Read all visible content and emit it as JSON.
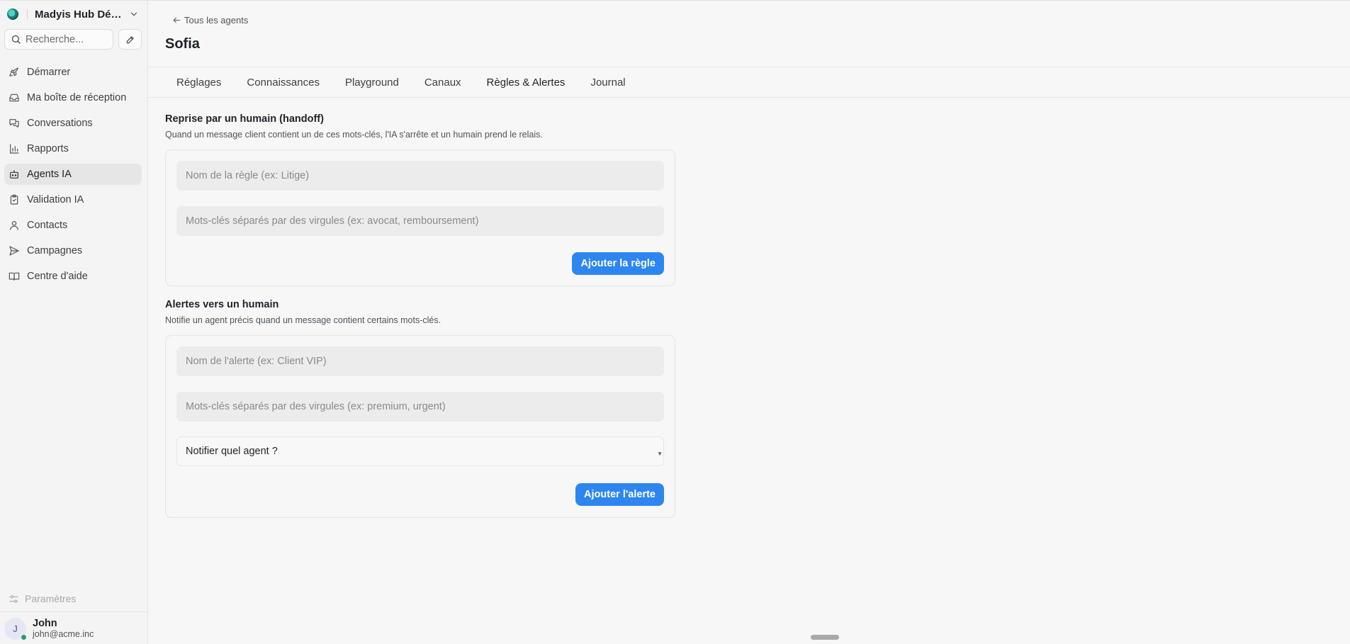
{
  "sidebar": {
    "workspace_name": "Madyis Hub Démo",
    "search_placeholder": "Recherche...",
    "items": [
      {
        "label": "Démarrer",
        "icon": "rocket-icon"
      },
      {
        "label": "Ma boîte de réception",
        "icon": "inbox-icon"
      },
      {
        "label": "Conversations",
        "icon": "chat-bubbles-icon"
      },
      {
        "label": "Rapports",
        "icon": "bar-chart-icon"
      },
      {
        "label": "Agents IA",
        "icon": "robot-icon",
        "active": true
      },
      {
        "label": "Validation IA",
        "icon": "clipboard-check-icon"
      },
      {
        "label": "Contacts",
        "icon": "user-icon"
      },
      {
        "label": "Campagnes",
        "icon": "send-icon"
      },
      {
        "label": "Centre d'aide",
        "icon": "book-icon"
      }
    ],
    "settings_label": "Paramètres",
    "user": {
      "initial": "J",
      "name": "John",
      "email": "john@acme.inc",
      "status_color": "#22a06b"
    }
  },
  "header": {
    "back_label": "Tous les agents",
    "title": "Sofia",
    "tabs": [
      {
        "label": "Réglages"
      },
      {
        "label": "Connaissances"
      },
      {
        "label": "Playground"
      },
      {
        "label": "Canaux"
      },
      {
        "label": "Règles & Alertes",
        "active": true
      },
      {
        "label": "Journal"
      }
    ]
  },
  "handoff": {
    "title": "Reprise par un humain (handoff)",
    "description": "Quand un message client contient un de ces mots-clés, l'IA s'arrête et un humain prend le relais.",
    "name_placeholder": "Nom de la règle (ex: Litige)",
    "keywords_placeholder": "Mots-clés séparés par des virgules (ex: avocat, remboursement)",
    "button_label": "Ajouter la règle"
  },
  "alerts": {
    "title": "Alertes vers un humain",
    "description": "Notifie un agent précis quand un message contient certains mots-clés.",
    "name_placeholder": "Nom de l'alerte (ex: Client VIP)",
    "keywords_placeholder": "Mots-clés séparés par des virgules (ex: premium, urgent)",
    "agent_select_label": "Notifier quel agent ?",
    "button_label": "Ajouter l'alerte"
  },
  "colors": {
    "accent": "#2d86f0",
    "active_nav_bg": "#e6e6e6"
  }
}
